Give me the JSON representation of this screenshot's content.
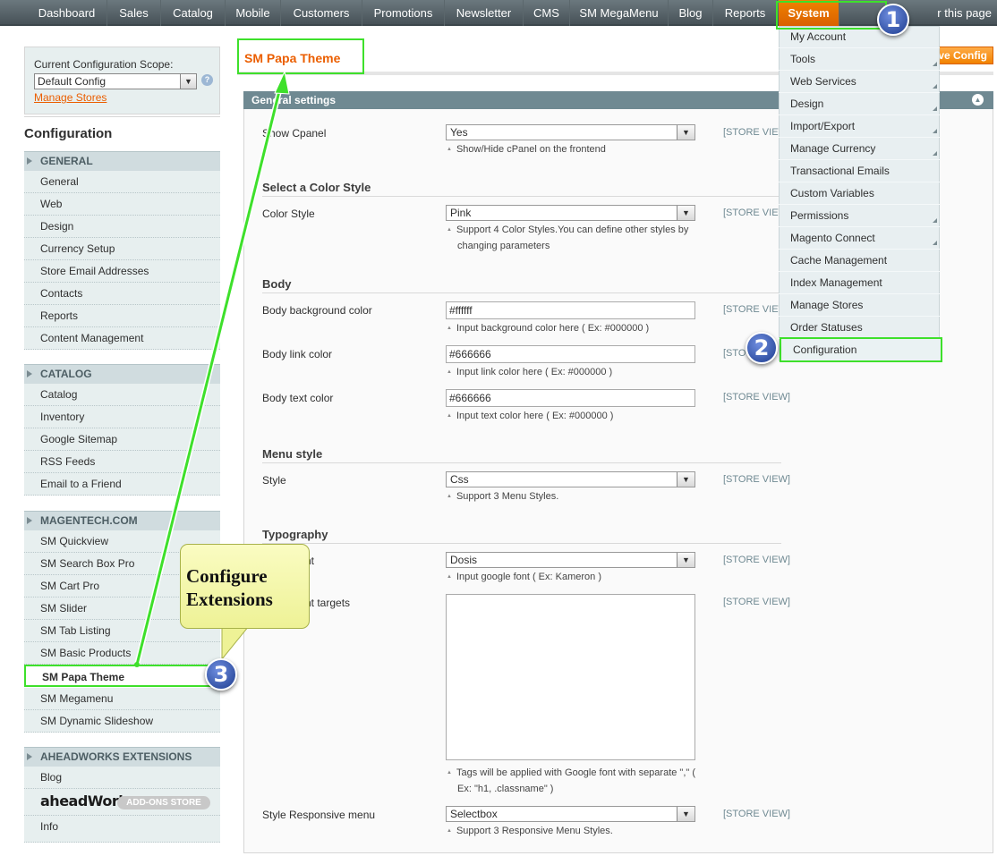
{
  "nav": {
    "items": [
      "Dashboard",
      "Sales",
      "Catalog",
      "Mobile",
      "Customers",
      "Promotions",
      "Newsletter",
      "CMS",
      "SM MegaMenu",
      "Blog",
      "Reports",
      "System"
    ],
    "active": "System",
    "helper_text": "r this page"
  },
  "scope": {
    "label": "Current Configuration Scope:",
    "value": "Default Config",
    "manage_link": "Manage Stores"
  },
  "sidebar": {
    "title": "Configuration",
    "sections": [
      {
        "title": "GENERAL",
        "items": [
          "General",
          "Web",
          "Design",
          "Currency Setup",
          "Store Email Addresses",
          "Contacts",
          "Reports",
          "Content Management"
        ]
      },
      {
        "title": "CATALOG",
        "items": [
          "Catalog",
          "Inventory",
          "Google Sitemap",
          "RSS Feeds",
          "Email to a Friend"
        ]
      },
      {
        "title": "MAGENTECH.COM",
        "items": [
          "SM Quickview",
          "SM Search Box Pro",
          "SM Cart Pro",
          "SM Slider",
          "SM Tab Listing",
          "SM Basic Products",
          "SM Papa Theme",
          "SM Megamenu",
          "SM Dynamic Slideshow"
        ]
      },
      {
        "title": "AHEADWORKS EXTENSIONS",
        "items": [
          "Blog",
          "Info"
        ]
      }
    ],
    "selected_item": "SM Papa Theme",
    "aw_logo": "aheadWorks",
    "aw_addons": "ADD-ONS STORE"
  },
  "main": {
    "page_title": "SM Papa Theme",
    "save_button": "ve Config",
    "panel_title": "General settings",
    "scope_label": "[STORE VIEW]",
    "scope_partial": "[STORE VIEW",
    "scope_partial2": "[STO",
    "fields": {
      "cpanel": {
        "label": "Show Cpanel",
        "value": "Yes",
        "note": "Show/Hide cPanel on the frontend"
      },
      "color_group": "Select a Color Style",
      "color": {
        "label": "Color Style",
        "value": "Pink",
        "note": "Support 4 Color Styles.You can define other styles by changing parameters"
      },
      "body_group": "Body",
      "bg_color": {
        "label": "Body background color",
        "value": "#ffffff",
        "note": "Input background color here ( Ex: #000000 )"
      },
      "link_color": {
        "label": "Body link color",
        "value": "#666666",
        "note": "Input link color here ( Ex: #000000 )"
      },
      "text_color": {
        "label": "Body text color",
        "value": "#666666",
        "note": "Input text color here ( Ex: #000000 )"
      },
      "menu_group": "Menu style",
      "menu_style": {
        "label": "Style",
        "value": "Css",
        "note": "Support 3 Menu Styles."
      },
      "typo_group": "Typography",
      "google_font": {
        "label": "nt",
        "value": "Dosis",
        "note": "Input google font ( Ex: Kameron )"
      },
      "font_targets": {
        "label": "nt targets",
        "note": "Tags will be applied with Google font with separate \",\" ( Ex: \"h1, .classname\" )"
      },
      "responsive_menu": {
        "label": "Style Responsive menu",
        "value": "Selectbox",
        "note": "Support 3 Responsive Menu Styles."
      }
    }
  },
  "system_menu": {
    "items": [
      "My Account",
      "Tools",
      "Web Services",
      "Design",
      "Import/Export",
      "Manage Currency",
      "Transactional Emails",
      "Custom Variables",
      "Permissions",
      "Magento Connect",
      "Cache Management",
      "Index Management",
      "Manage Stores",
      "Order Statuses",
      "Configuration"
    ],
    "highlighted": "Configuration"
  },
  "annotations": {
    "badges": [
      "1",
      "2",
      "3"
    ],
    "callout": "Configure Extensions",
    "accent_color": "#3ee02b"
  }
}
